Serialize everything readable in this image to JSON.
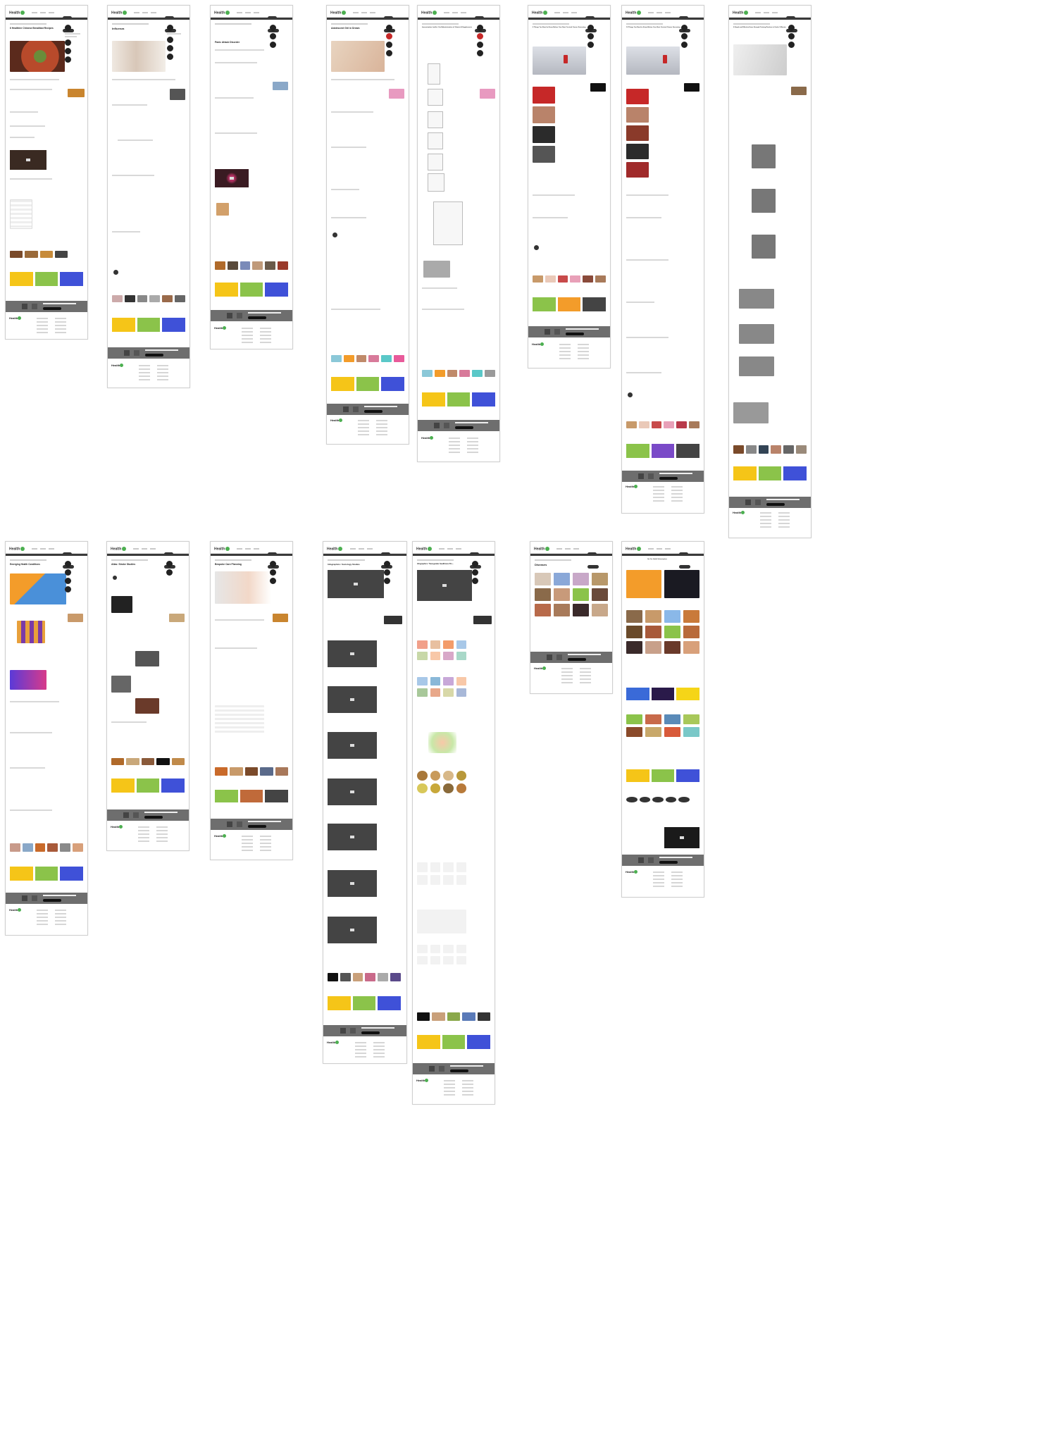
{
  "brand": {
    "logo_text": "Health",
    "accent": "#4caf50",
    "dark": "#333333",
    "footer_band": "#6e6e6e"
  },
  "pages": [
    {
      "title": "6 Healthier Chinese Breakfast Recipes"
    },
    {
      "title": "Influenza"
    },
    {
      "title": "Panic Attack Disorder"
    },
    {
      "title": "Adolescent Girl in Dream"
    },
    {
      "title": "Immunization Leaflet: Oral Administration of Vitamin A Supplements"
    },
    {
      "title": "6 Things You Need to Know Before Your Next Cervical Cancer Screening"
    },
    {
      "title": "10 Things You Need to Know Before Your Next Cervical Cancer Screening"
    },
    {
      "title": "6 Simple and Effective Home Strength Training Routines in Under 3 Minutes"
    },
    {
      "title": "Emerging Health Conditions"
    },
    {
      "title": "Atlas: Stroke Studies"
    },
    {
      "title": "Bespoke Care Planning"
    },
    {
      "title": "Infographics: Sociology Studies"
    },
    {
      "title": "Infographics: Transgender Healthcare Pro..."
    },
    {
      "title": "Diseases"
    },
    {
      "title": "Get Our Health Subscriptions"
    }
  ],
  "colors": {
    "food": "#b84a2b",
    "skin": "#e8d7c5",
    "yellow": "#f5c518",
    "blue": "#3f51d8",
    "green": "#8bc34a",
    "orange": "#f39c2a",
    "photo": "#7d7d7d",
    "dark_photo": "#2b2b2b",
    "red": "#c62828"
  }
}
